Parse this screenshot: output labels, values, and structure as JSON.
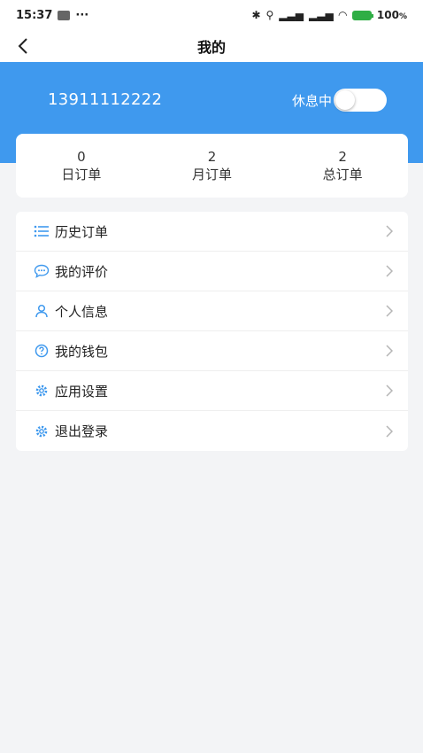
{
  "status_bar": {
    "time": "15:37",
    "dots": "···",
    "battery": "100"
  },
  "header": {
    "title": "我的"
  },
  "profile": {
    "phone": "13911112222",
    "rest_label": "休息中"
  },
  "stats": [
    {
      "value": "0",
      "label": "日订单"
    },
    {
      "value": "2",
      "label": "月订单"
    },
    {
      "value": "2",
      "label": "总订单"
    }
  ],
  "menu": [
    {
      "label": "历史订单",
      "icon": "list-icon"
    },
    {
      "label": "我的评价",
      "icon": "chat-bubble-icon"
    },
    {
      "label": "个人信息",
      "icon": "person-icon"
    },
    {
      "label": "我的钱包",
      "icon": "question-circle-icon"
    },
    {
      "label": "应用设置",
      "icon": "gear-icon"
    },
    {
      "label": "退出登录",
      "icon": "gear-icon"
    }
  ],
  "colors": {
    "accent": "#3f99ee",
    "background": "#f3f4f6"
  }
}
